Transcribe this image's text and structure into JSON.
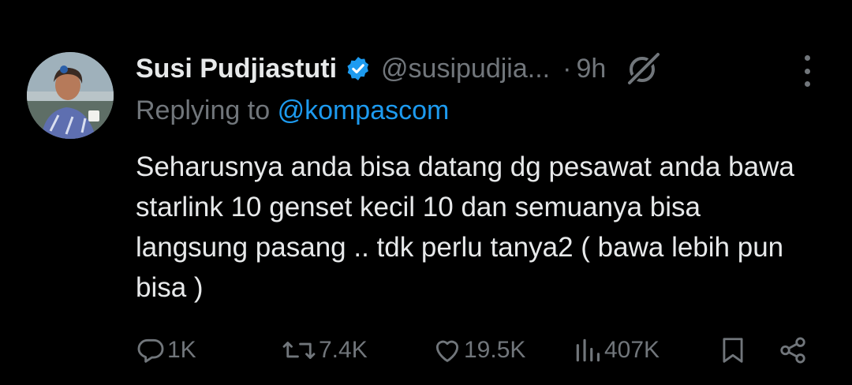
{
  "tweet": {
    "author_name": "Susi Pudjiastuti",
    "handle": "@susipudjia...",
    "separator": "·",
    "time": "9h",
    "reply_prefix": "Replying to",
    "reply_mention": "@kompascom",
    "text": "Seharusnya anda bisa datang dg pesawat anda bawa starlink 10 genset kecil 10 dan semuanya bisa langsung pasang .. tdk perlu tanya2 ( bawa lebih pun bisa )"
  },
  "actions": {
    "replies": "1K",
    "reposts": "7.4K",
    "likes": "19.5K",
    "views": "407K"
  },
  "colors": {
    "background": "#000000",
    "text": "#e7e9ea",
    "muted": "#71767b",
    "link": "#1d9bf0",
    "verified": "#1d9bf0"
  },
  "icons": [
    "verified-badge-icon",
    "grok-icon",
    "more-options-icon",
    "reply-icon",
    "repost-icon",
    "like-icon",
    "views-icon",
    "bookmark-icon",
    "share-icon"
  ]
}
